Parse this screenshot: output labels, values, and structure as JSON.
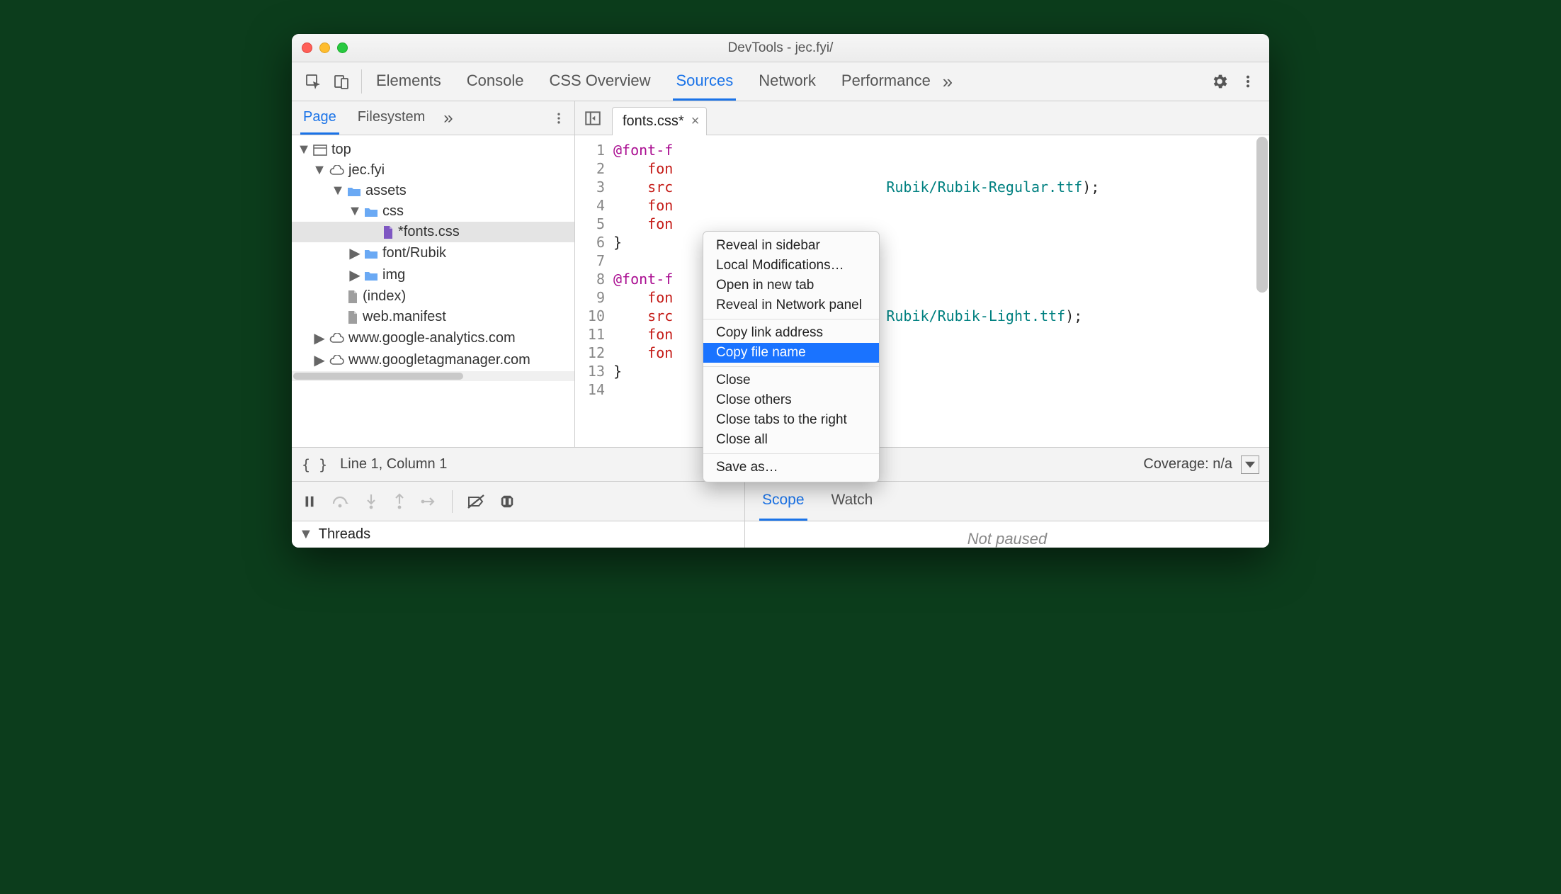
{
  "window": {
    "title": "DevTools - jec.fyi/"
  },
  "toolbar": {
    "tabs": [
      "Elements",
      "Console",
      "CSS Overview",
      "Sources",
      "Network",
      "Performance"
    ],
    "active_tab": "Sources",
    "more_glyph": "»"
  },
  "navigator": {
    "tabs": [
      "Page",
      "Filesystem"
    ],
    "active_tab": "Page",
    "more_glyph": "»"
  },
  "file_tab": {
    "label": "fonts.css*",
    "close_glyph": "×"
  },
  "tree": {
    "rows": [
      {
        "twisty": "▼",
        "icon": "frame",
        "label": "top",
        "indent": 0
      },
      {
        "twisty": "▼",
        "icon": "cloud",
        "label": "jec.fyi",
        "indent": 1
      },
      {
        "twisty": "▼",
        "icon": "folder",
        "label": "assets",
        "indent": 2
      },
      {
        "twisty": "▼",
        "icon": "folder",
        "label": "css",
        "indent": 3
      },
      {
        "twisty": "",
        "icon": "filep",
        "label": "*fonts.css",
        "indent": 4,
        "selected": true
      },
      {
        "twisty": "▶",
        "icon": "folder",
        "label": "font/Rubik",
        "indent": 3
      },
      {
        "twisty": "▶",
        "icon": "folder",
        "label": "img",
        "indent": 3
      },
      {
        "twisty": "",
        "icon": "file",
        "label": "(index)",
        "indent": 2
      },
      {
        "twisty": "",
        "icon": "file",
        "label": "web.manifest",
        "indent": 2
      },
      {
        "twisty": "▶",
        "icon": "cloud",
        "label": "www.google-analytics.com",
        "indent": 1
      },
      {
        "twisty": "▶",
        "icon": "cloud",
        "label": "www.googletagmanager.com",
        "indent": 1
      }
    ]
  },
  "code": {
    "line_count": 14,
    "lines": [
      [
        {
          "t": "@font-f",
          "c": "kw"
        }
      ],
      [
        {
          "t": "    fon",
          "c": "prop"
        }
      ],
      [
        {
          "t": "    src",
          "c": "prop"
        },
        {
          "t": "                         ",
          "c": ""
        },
        {
          "t": "Rubik/Rubik-Regular.ttf",
          "c": "url"
        },
        {
          "t": ");",
          "c": ""
        }
      ],
      [
        {
          "t": "    fon",
          "c": "prop"
        }
      ],
      [
        {
          "t": "    fon",
          "c": "prop"
        }
      ],
      [
        {
          "t": "}",
          "c": ""
        }
      ],
      [
        {
          "t": "",
          "c": ""
        }
      ],
      [
        {
          "t": "@font-f",
          "c": "kw"
        }
      ],
      [
        {
          "t": "    fon",
          "c": "prop"
        }
      ],
      [
        {
          "t": "    src",
          "c": "prop"
        },
        {
          "t": "                         ",
          "c": ""
        },
        {
          "t": "Rubik/Rubik-Light.ttf",
          "c": "url"
        },
        {
          "t": ");",
          "c": ""
        }
      ],
      [
        {
          "t": "    fon",
          "c": "prop"
        }
      ],
      [
        {
          "t": "    fon",
          "c": "prop"
        }
      ],
      [
        {
          "t": "}",
          "c": ""
        }
      ],
      [
        {
          "t": "",
          "c": ""
        }
      ]
    ]
  },
  "context_menu": {
    "groups": [
      [
        "Reveal in sidebar",
        "Local Modifications…",
        "Open in new tab",
        "Reveal in Network panel"
      ],
      [
        "Copy link address",
        "Copy file name"
      ],
      [
        "Close",
        "Close others",
        "Close tabs to the right",
        "Close all"
      ],
      [
        "Save as…"
      ]
    ],
    "highlight": "Copy file name"
  },
  "status": {
    "braces": "{ }",
    "position": "Line 1, Column 1",
    "coverage": "Coverage: n/a"
  },
  "debugger_tabs": {
    "tabs": [
      "Scope",
      "Watch"
    ],
    "active": "Scope"
  },
  "threads": {
    "label": "Threads",
    "twisty": "▼"
  },
  "not_paused": "Not paused"
}
